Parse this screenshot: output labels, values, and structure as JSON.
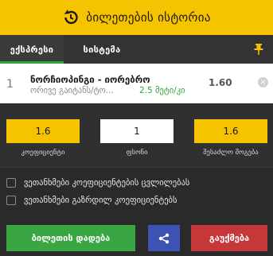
{
  "header": {
    "title": "ბილეთების ისტორია",
    "icon": "history-icon"
  },
  "tabs": [
    {
      "label": "ექსპრესი",
      "active": true
    },
    {
      "label": "სისტემა",
      "active": false
    }
  ],
  "pin_icon": "pin-icon",
  "bet": {
    "number": "1",
    "match": "ნორჩიოპინგი - იორებრო",
    "market": "ორივე გაიტანს/ტო...",
    "pick": "2.5 მეტი/კი",
    "odd": "1.60"
  },
  "calculator": {
    "coefficient": {
      "value": "1.6",
      "label": "კოეფიციენტი"
    },
    "stake": {
      "value": "1",
      "label": "ფსონი"
    },
    "winnings": {
      "value": "1.6",
      "label": "შესაძლო მოგება"
    }
  },
  "options": [
    {
      "label": "ვეთანხმები კოეფიციენტების ცვლილებას",
      "checked": false
    },
    {
      "label": "ვეთანხმები გაზრდილ კოეფიციენტებს",
      "checked": false
    }
  ],
  "actions": {
    "place": "ბილეთის დადება",
    "clear": "გაუქმება",
    "share_icon": "share-icon"
  },
  "colors": {
    "accent": "#f6c300",
    "green": "#3aa543",
    "blue": "#3d53b3",
    "red": "#c6373a",
    "background": "#2a2a2a"
  }
}
